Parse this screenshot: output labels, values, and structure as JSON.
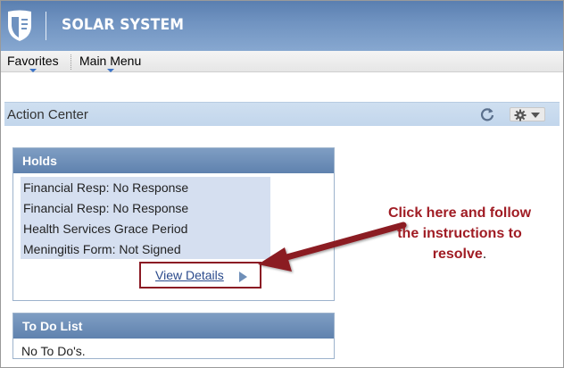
{
  "app": {
    "title": "SOLAR SYSTEM"
  },
  "menubar": {
    "items": [
      {
        "label": "Favorites"
      },
      {
        "label": "Main Menu"
      }
    ]
  },
  "action_center": {
    "title": "Action Center",
    "icons": [
      "refresh-icon",
      "gear-icon",
      "chevron-down-icon"
    ]
  },
  "holds": {
    "title": "Holds",
    "items": [
      "Financial Resp: No Response",
      "Financial Resp: No Response",
      "Health Services Grace Period",
      "Meningitis Form: Not Signed"
    ],
    "view_details_label": "View Details"
  },
  "todo": {
    "title": "To Do List",
    "empty_text": "No To Do's."
  },
  "annotation": {
    "text": "Click here and follow the instructions to resolve",
    "period": ".",
    "color": "#a01c24"
  },
  "colors": {
    "banner": "#6f92c0",
    "pagelet_header": "#6f8fb8",
    "highlight": "#8b1a24"
  }
}
